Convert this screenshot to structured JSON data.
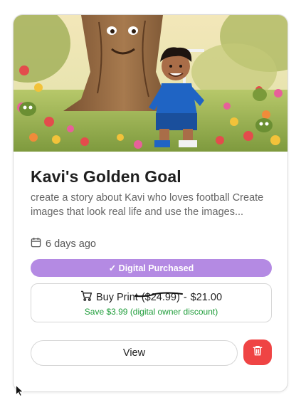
{
  "card": {
    "title": "Kavi's Golden Goal",
    "description": "create a story about Kavi who loves football Create images that look real life and use the images...",
    "date": "6 days ago",
    "badge": "✓ Digital Purchased",
    "buy": {
      "label": "Buy Print",
      "old_price": "($24.99)",
      "separator": "-",
      "price": "$21.00",
      "discount_note": "Save $3.99 (digital owner discount)"
    },
    "view_label": "View"
  },
  "icons": {
    "date": "calendar-icon",
    "buy": "cart-icon",
    "delete": "trash-icon",
    "cursor": "mouse-pointer-icon"
  },
  "colors": {
    "badge": "#b48ae3",
    "delete": "#ef4444",
    "discount": "#1f9d3a"
  }
}
